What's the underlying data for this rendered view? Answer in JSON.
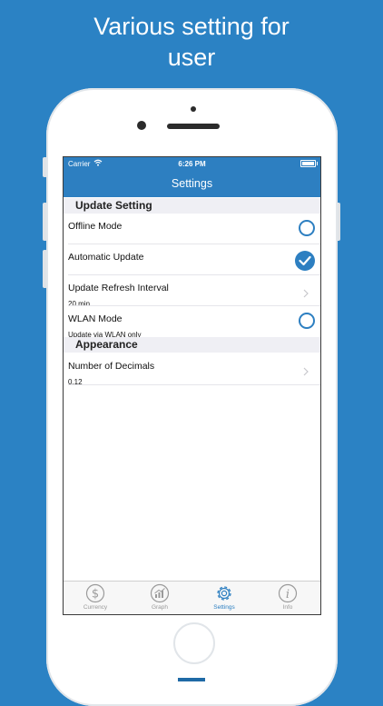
{
  "headline": {
    "line1": "Various setting for",
    "line2": "user"
  },
  "status_bar": {
    "carrier": "Carrier",
    "time": "6:26 PM"
  },
  "navbar": {
    "title": "Settings"
  },
  "sections": [
    {
      "header": "Update Setting",
      "rows": [
        {
          "label": "Offline Mode",
          "control": "radio",
          "checked": false
        },
        {
          "label": "Automatic Update",
          "control": "radio",
          "checked": true
        },
        {
          "label": "Update Refresh Interval",
          "value": "20 min",
          "control": "disclosure"
        },
        {
          "label": "WLAN Mode",
          "value": "Update via WLAN only",
          "control": "radio",
          "checked": false
        }
      ]
    },
    {
      "header": "Appearance",
      "rows": [
        {
          "label": "Number of Decimals",
          "value": "0.12",
          "control": "disclosure"
        }
      ]
    }
  ],
  "tabbar": {
    "active": "Settings",
    "items": [
      {
        "label": "Currency",
        "icon": "dollar-icon"
      },
      {
        "label": "Graph",
        "icon": "graph-icon"
      },
      {
        "label": "Settings",
        "icon": "gear-icon"
      },
      {
        "label": "Info",
        "icon": "info-icon"
      }
    ]
  },
  "colors": {
    "background": "#2b82c4",
    "accent": "#2d7fc1",
    "inactive_tab": "#9a9a9a"
  }
}
